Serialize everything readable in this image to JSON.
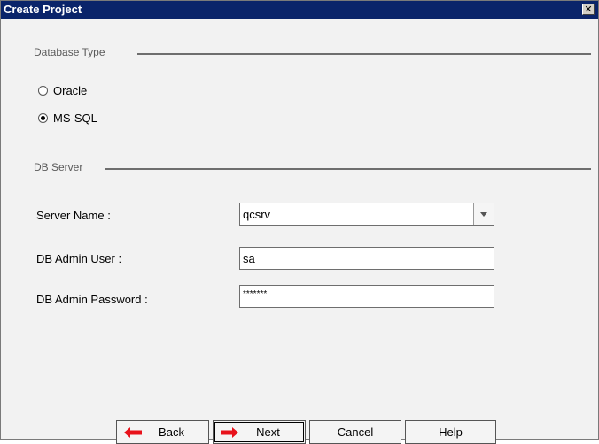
{
  "window": {
    "title": "Create Project",
    "close_glyph": "✕"
  },
  "database_type": {
    "section_label": "Database Type",
    "options": [
      {
        "label": "Oracle",
        "checked": false
      },
      {
        "label": "MS-SQL",
        "checked": true
      }
    ]
  },
  "db_server": {
    "section_label": "DB Server",
    "server_name": {
      "label": "Server Name :",
      "value": "qcsrv"
    },
    "admin_user": {
      "label": "DB Admin User :",
      "value": "sa"
    },
    "admin_password": {
      "label": "DB Admin Password :",
      "value": "*******"
    }
  },
  "buttons": {
    "back": "Back",
    "next": "Next",
    "cancel": "Cancel",
    "help": "Help"
  },
  "colors": {
    "arrow_red": "#e8121b",
    "titlebar": "#0a246a"
  }
}
